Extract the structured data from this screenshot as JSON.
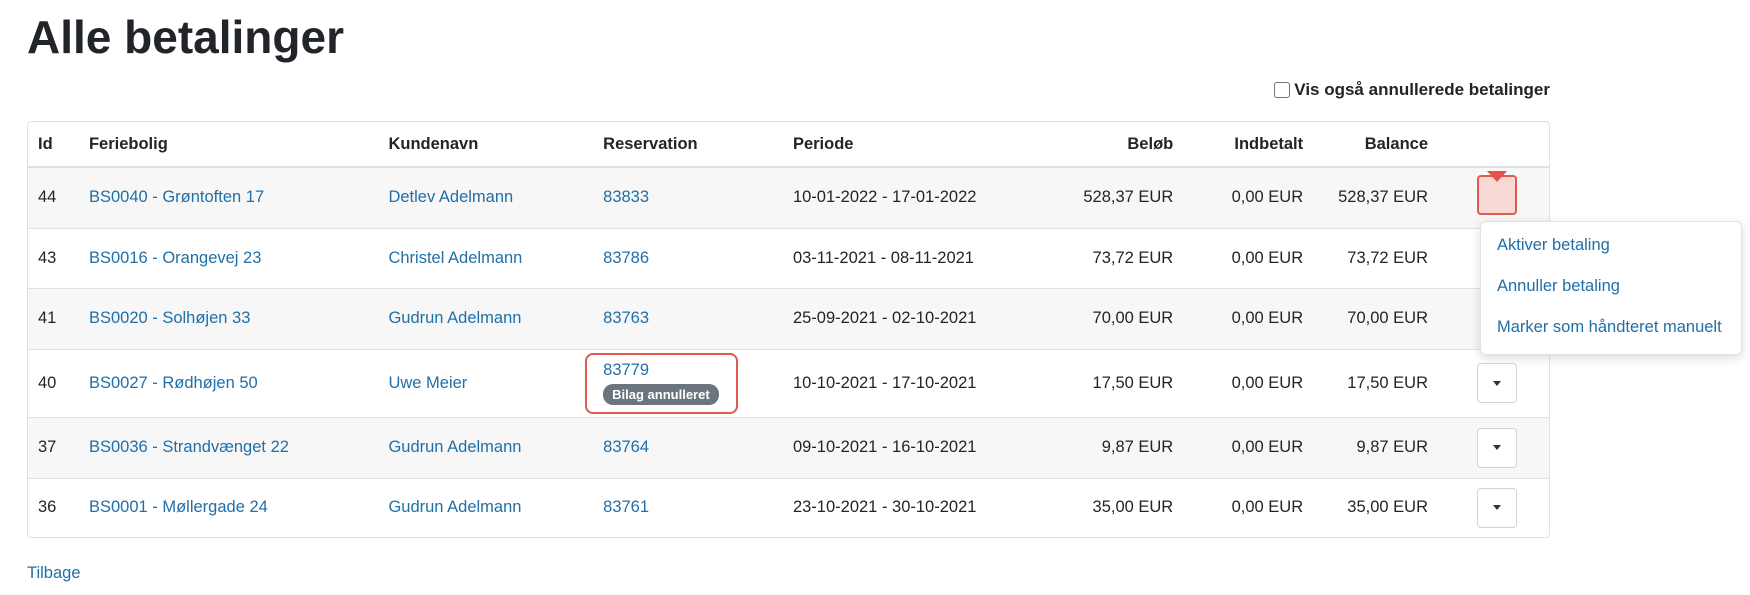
{
  "page_title": "Alle betalinger",
  "filter": {
    "label": "Vis også annullerede betalinger",
    "checked": false
  },
  "table": {
    "headers": {
      "id": "Id",
      "property": "Feriebolig",
      "customer": "Kundenavn",
      "reservation": "Reservation",
      "period": "Periode",
      "amount": "Beløb",
      "paid": "Indbetalt",
      "balance": "Balance"
    },
    "rows": [
      {
        "id": "44",
        "property": "BS0040 - Grøntoften 17",
        "customer": "Detlev Adelmann",
        "reservation": "83833",
        "period": "10-01-2022 - 17-01-2022",
        "amount": "528,37 EUR",
        "paid": "0,00 EUR",
        "balance": "528,37 EUR"
      },
      {
        "id": "43",
        "property": "BS0016 - Orangevej 23",
        "customer": "Christel Adelmann",
        "reservation": "83786",
        "period": "03-11-2021 - 08-11-2021",
        "amount": "73,72 EUR",
        "paid": "0,00 EUR",
        "balance": "73,72 EUR"
      },
      {
        "id": "41",
        "property": "BS0020 - Solhøjen 33",
        "customer": "Gudrun Adelmann",
        "reservation": "83763",
        "period": "25-09-2021 - 02-10-2021",
        "amount": "70,00 EUR",
        "paid": "0,00 EUR",
        "balance": "70,00 EUR"
      },
      {
        "id": "40",
        "property": "BS0027 - Rødhøjen 50",
        "customer": "Uwe Meier",
        "reservation": "83779",
        "badge": "Bilag annulleret",
        "period": "10-10-2021 - 17-10-2021",
        "amount": "17,50 EUR",
        "paid": "0,00 EUR",
        "balance": "17,50 EUR"
      },
      {
        "id": "37",
        "property": "BS0036 - Strandvænget 22",
        "customer": "Gudrun Adelmann",
        "reservation": "83764",
        "period": "09-10-2021 - 16-10-2021",
        "amount": "9,87 EUR",
        "paid": "0,00 EUR",
        "balance": "9,87 EUR"
      },
      {
        "id": "36",
        "property": "BS0001 - Møllergade 24",
        "customer": "Gudrun Adelmann",
        "reservation": "83761",
        "period": "23-10-2021 - 30-10-2021",
        "amount": "35,00 EUR",
        "paid": "0,00 EUR",
        "balance": "35,00 EUR"
      }
    ]
  },
  "dropdown_menu": {
    "items": [
      "Aktiver betaling",
      "Annuller betaling",
      "Marker som håndteret manuelt"
    ]
  },
  "back_link": "Tilbage",
  "colors": {
    "link": "#1f6fa8",
    "highlight": "#e05a4f",
    "badge": "#6c757d"
  },
  "icons": {
    "dropdown": "caret-down-icon",
    "annotation": "arrow-down-icon"
  }
}
